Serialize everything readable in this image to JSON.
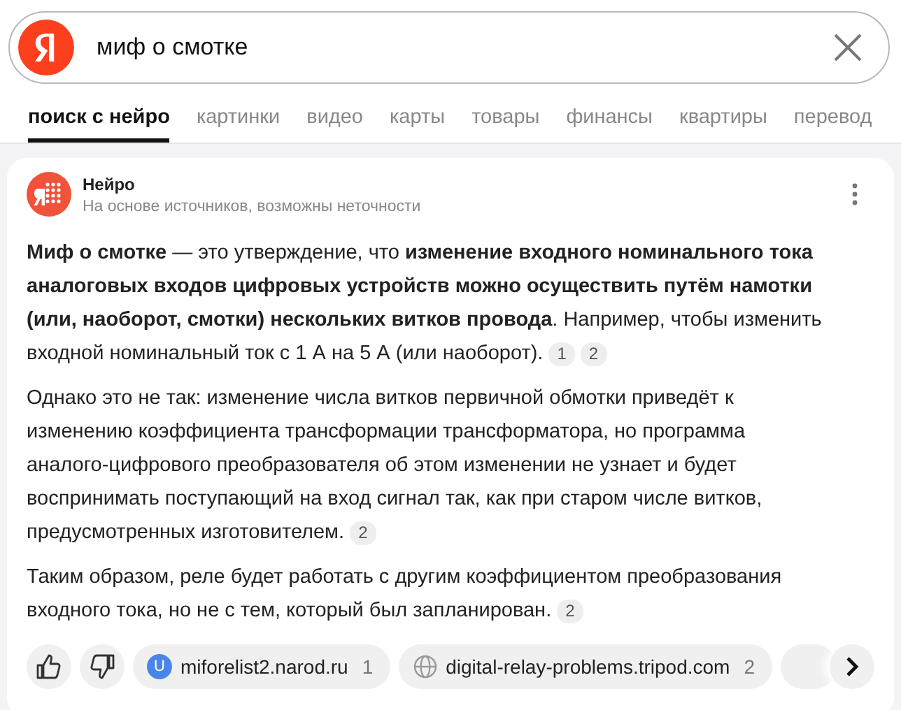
{
  "search": {
    "value": "миф о смотке"
  },
  "tabs": [
    {
      "label": "поиск с нейро",
      "selected": true
    },
    {
      "label": "картинки",
      "selected": false
    },
    {
      "label": "видео",
      "selected": false
    },
    {
      "label": "карты",
      "selected": false
    },
    {
      "label": "товары",
      "selected": false
    },
    {
      "label": "финансы",
      "selected": false
    },
    {
      "label": "квартиры",
      "selected": false
    },
    {
      "label": "перевод",
      "selected": false
    }
  ],
  "answer": {
    "title": "Нейро",
    "subtitle": "На основе источников, возможны неточности",
    "paragraphs": [
      {
        "text": "**Миф о смотке** — это утверждение, что **изменение входного номинального тока аналоговых входов цифровых устройств можно осуществить путём намотки (или, наоборот, смотки) нескольких витков провода**. Например, чтобы изменить входной номинальный ток с 1 А на 5 А (или наоборот).",
        "citations": [
          "1",
          "2"
        ]
      },
      {
        "text": "Однако это не так: изменение числа витков первичной обмотки приведёт к изменению коэффициента трансформации трансформатора, но программа аналого-цифрового преобразователя об этом изменении не узнает и будет воспринимать поступающий на вход сигнал так, как при старом числе витков, предусмотренных изготовителем.",
        "citations": [
          "2"
        ]
      },
      {
        "text": "Таким образом, реле будет работать с другим коэффициентом преобразования входного тока, но не с тем, который был запланирован.",
        "citations": [
          "2"
        ]
      }
    ],
    "sources": [
      {
        "kind": "letter",
        "letter": "U",
        "name": "miforelist2.narod.ru",
        "count": "1"
      },
      {
        "kind": "globe",
        "name": "digital-relay-problems.tripod.com",
        "count": "2"
      }
    ]
  }
}
